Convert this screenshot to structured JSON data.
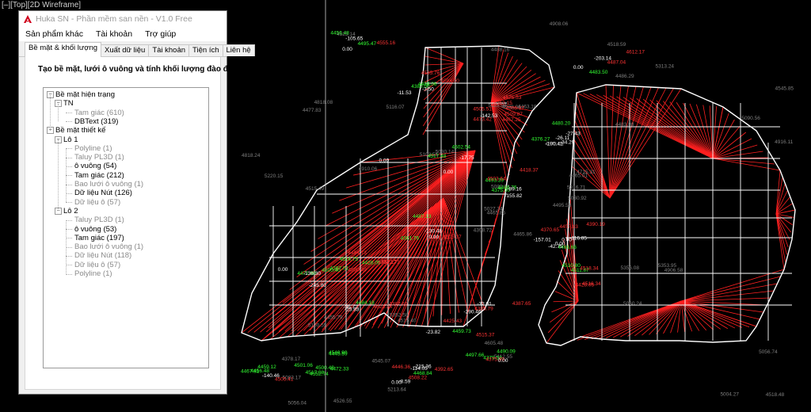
{
  "viewport": {
    "label": "[–][Top][2D Wireframe]"
  },
  "window": {
    "title": "Huka SN - Phần mềm san nền - V1.0 Free",
    "icon": "autocad-a-icon"
  },
  "menu": [
    "Sản phẩm khác",
    "Tài khoản",
    "Trợ giúp"
  ],
  "tabs": [
    "Bề mặt & khối lượng",
    "Xuất dữ liệu",
    "Tài khoản",
    "Tiện ích",
    "Liên hệ"
  ],
  "panel": {
    "heading": "Tạo bề mặt, lưới ô vuông và tính khối lượng đào đắp"
  },
  "tree": [
    {
      "label": "Bề mặt hiện trạng",
      "level": 0,
      "toggle": "−",
      "dim": false
    },
    {
      "label": "TN",
      "level": 1,
      "toggle": "−",
      "dim": false
    },
    {
      "label": "Tam giác (610)",
      "level": 2,
      "toggle": "",
      "dim": true
    },
    {
      "label": "DBText (319)",
      "level": 2,
      "toggle": "",
      "dim": false
    },
    {
      "label": "Bề mặt thiết kế",
      "level": 0,
      "toggle": "−",
      "dim": false
    },
    {
      "label": "Lô 1",
      "level": 1,
      "toggle": "−",
      "dim": false
    },
    {
      "label": "Polyline (1)",
      "level": 2,
      "toggle": "",
      "dim": true
    },
    {
      "label": "Taluy PL3D (1)",
      "level": 2,
      "toggle": "",
      "dim": true
    },
    {
      "label": "ô vuông (54)",
      "level": 2,
      "toggle": "",
      "dim": false
    },
    {
      "label": "Tam giác (212)",
      "level": 2,
      "toggle": "",
      "dim": false
    },
    {
      "label": "Bao lưới ô vuông (1)",
      "level": 2,
      "toggle": "",
      "dim": true
    },
    {
      "label": "Dữ liệu Nút (126)",
      "level": 2,
      "toggle": "",
      "dim": false
    },
    {
      "label": "Dữ liệu ô (57)",
      "level": 2,
      "toggle": "",
      "dim": true
    },
    {
      "label": "Lô 2",
      "level": 1,
      "toggle": "−",
      "dim": false
    },
    {
      "label": "Taluy PL3D (1)",
      "level": 2,
      "toggle": "",
      "dim": true
    },
    {
      "label": "ô vuông (53)",
      "level": 2,
      "toggle": "",
      "dim": false
    },
    {
      "label": "Tam giác (197)",
      "level": 2,
      "toggle": "",
      "dim": false
    },
    {
      "label": "Bao lưới ô vuông (1)",
      "level": 2,
      "toggle": "",
      "dim": true
    },
    {
      "label": "Dữ liệu Nút (118)",
      "level": 2,
      "toggle": "",
      "dim": true
    },
    {
      "label": "Dữ liệu ô (57)",
      "level": 2,
      "toggle": "",
      "dim": true
    },
    {
      "label": "Polyline (1)",
      "level": 2,
      "toggle": "",
      "dim": true
    }
  ],
  "colors": {
    "background": "#000000",
    "boundary": "#ffffff",
    "triangles": "#ff2020",
    "label_green": "#33ff33",
    "label_red": "#ff3333",
    "label_gray": "#7f7f7f"
  },
  "drawing_labels": {
    "gray": [
      "4465.86",
      "4477.83",
      "4465.85",
      "4378.17",
      "4465.01",
      "4515.40",
      "4518.59",
      "4463.18",
      "4486.29",
      "4495.58",
      "4523.14",
      "4518.48",
      "4515.49",
      "4545.85",
      "4398.72",
      "4483.88",
      "4526.55",
      "5115.98",
      "4373.61",
      "4455.79",
      "5030.14",
      "5083.17",
      "4545.07",
      "4908.06",
      "4715.31",
      "4906.58",
      "4818.08",
      "4488.16",
      "5220.15",
      "5356.08",
      "4916.11",
      "5027.34",
      "4605.48",
      "5082.03",
      "5116.07",
      "5313.24",
      "5352.58",
      "5004.27",
      "5056.74",
      "5353.95",
      "4908.06",
      "5103.55",
      "4910.06",
      "5060.24",
      "5213.64",
      "4818.24",
      "5316.71",
      "5056.04",
      "5112.55",
      "5030.92",
      "5100.55",
      "5090.56"
    ],
    "red": [
      "4428.05",
      "4385.79",
      "4503.64",
      "4515.37",
      "4509.87",
      "4535.76",
      "4612.17",
      "4505.51",
      "4473.42",
      "4508.22",
      "4505.41",
      "4487.04",
      "4484.73",
      "4390.19",
      "4446.36",
      "4394.17",
      "4370.65",
      "4504.00",
      "4363.15",
      "4508.37",
      "4387.65",
      "4375.99",
      "4489.10",
      "4387.65",
      "4518.34",
      "4522.34",
      "4467.25",
      "4575.53",
      "4392.65",
      "4515.37",
      "4418.37",
      "4425.43",
      "4457.83",
      "4522.71",
      "4500.49",
      "4555.16",
      "4516.34"
    ],
    "green": [
      "4428.05",
      "4517.08",
      "4511.87",
      "4456.48",
      "4375.00",
      "4459.12",
      "4387.01",
      "4380.00",
      "4514.75",
      "4510.80",
      "4480.20",
      "4361.76",
      "4487.13",
      "4488.06",
      "4501.06",
      "4500.40",
      "4497.66",
      "4376.27",
      "4502.54",
      "4495.47",
      "4484.18",
      "4500.48",
      "4467.81",
      "4459.73",
      "4540.90",
      "4379.58",
      "4468.84",
      "4472.90",
      "4445.59",
      "4456.48",
      "4466.66",
      "4483.50",
      "4517.48",
      "4490.09",
      "4552.74",
      "4472.33",
      "4446.76",
      "4493.39"
    ],
    "white": [
      "0.00",
      "-34.29",
      "-11.53",
      "-23.82",
      "-17.75",
      "-27.43",
      "-15.83",
      "-155.82",
      "-130.48",
      "-142.53",
      "-3.50",
      "-26.11",
      "-105.65",
      "-215.36",
      "-290.46",
      "-245.80",
      "-140.46",
      "-36.72",
      "-32.01",
      "-136.30",
      "-203.14",
      "-190.41",
      "-157.01",
      "-89.16",
      "-8.59",
      "-114.05",
      "-116.85",
      "-42.75",
      "0.00",
      "0.00",
      "0.00",
      "0.00",
      "0.00",
      "0.00",
      "0.00",
      "0.00",
      "0.00"
    ]
  }
}
